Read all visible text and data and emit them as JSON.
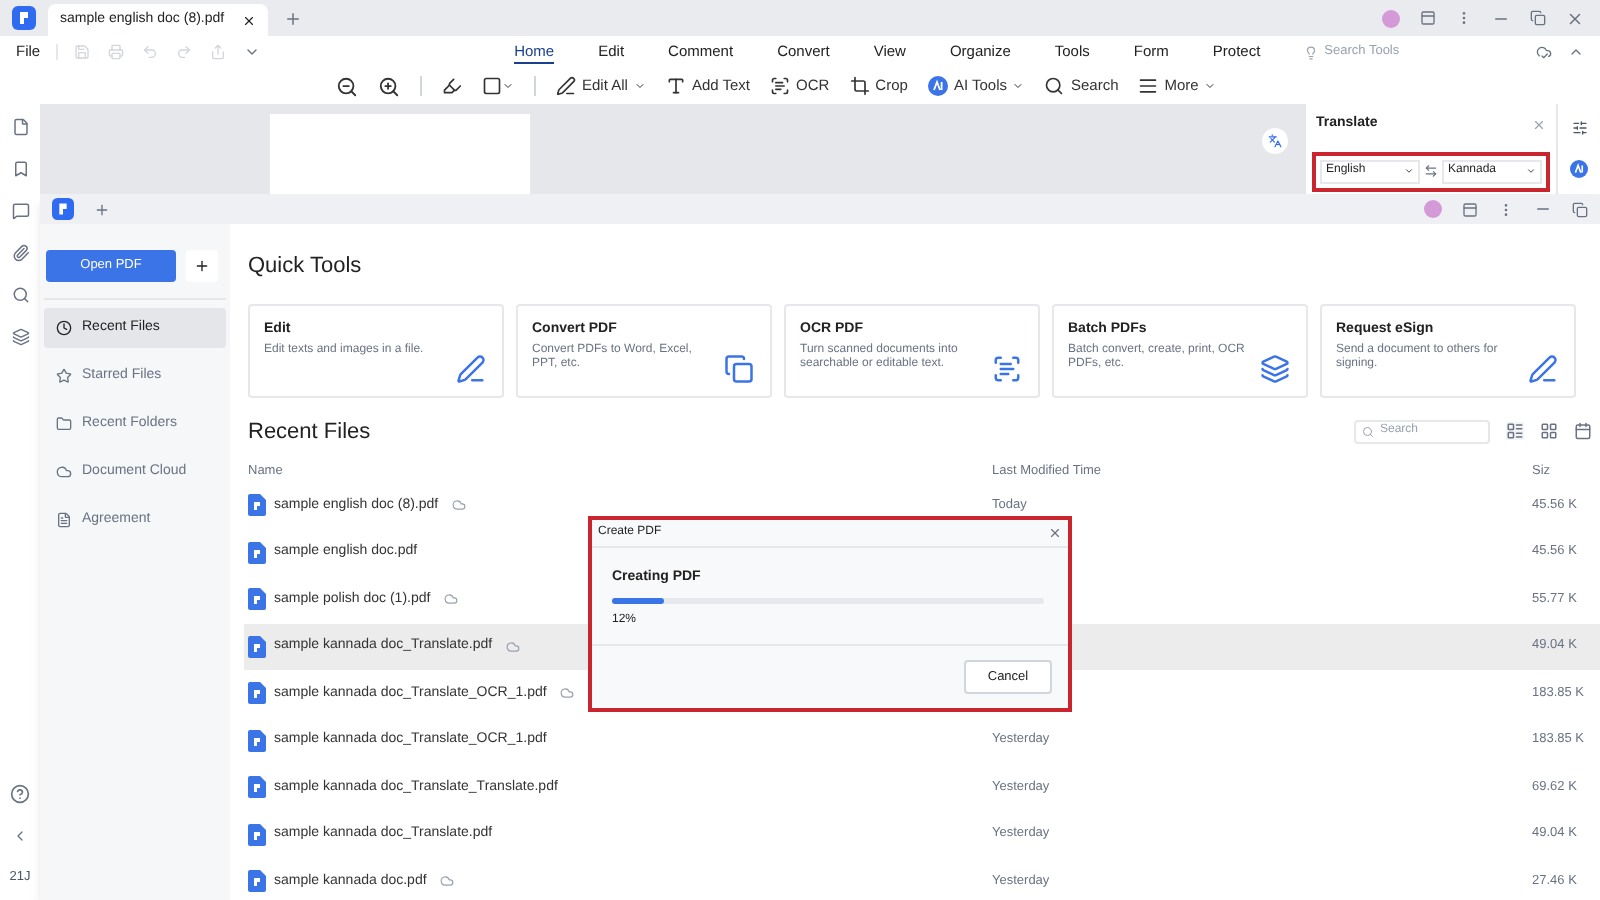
{
  "back_window": {
    "tab_title": "sample english doc (8).pdf",
    "file_menu": "File",
    "ribbon_tabs": [
      {
        "label": "Home",
        "selected": true
      },
      {
        "label": "Edit",
        "selected": false
      },
      {
        "label": "Comment",
        "selected": false
      },
      {
        "label": "Convert",
        "selected": false
      },
      {
        "label": "View",
        "selected": false
      },
      {
        "label": "Organize",
        "selected": false
      },
      {
        "label": "Tools",
        "selected": false
      },
      {
        "label": "Form",
        "selected": false
      },
      {
        "label": "Protect",
        "selected": false
      }
    ],
    "search_tools": {
      "placeholder": "Search Tools"
    },
    "toolbar_buttons": [
      {
        "label": "Edit All",
        "dropdown": true
      },
      {
        "label": "Add Text",
        "dropdown": false
      },
      {
        "label": "OCR",
        "dropdown": false
      },
      {
        "label": "Crop",
        "dropdown": false
      },
      {
        "label": "AI Tools",
        "dropdown": true
      },
      {
        "label": "Search",
        "dropdown": false
      },
      {
        "label": "More",
        "dropdown": true
      }
    ],
    "translate_panel": {
      "title": "Translate",
      "source_language": "English",
      "target_language": "Kannada"
    },
    "rail_label": "21J"
  },
  "home_window": {
    "open_pdf": "Open PDF",
    "nav_items": [
      {
        "label": "Recent Files",
        "selected": true
      },
      {
        "label": "Starred Files",
        "selected": false
      },
      {
        "label": "Recent Folders",
        "selected": false
      },
      {
        "label": "Document Cloud",
        "selected": false
      },
      {
        "label": "Agreement",
        "selected": false
      }
    ],
    "quick_tools_title": "Quick Tools",
    "quick_tools": [
      {
        "title": "Edit",
        "description": "Edit texts and images in a file."
      },
      {
        "title": "Convert PDF",
        "description": "Convert PDFs to Word, Excel, PPT, etc."
      },
      {
        "title": "OCR PDF",
        "description": "Turn scanned documents into searchable or editable text."
      },
      {
        "title": "Batch PDFs",
        "description": "Batch convert, create, print, OCR PDFs, etc."
      },
      {
        "title": "Request eSign",
        "description": "Send a document to others for signing."
      }
    ],
    "recent_title": "Recent Files",
    "search": {
      "placeholder": "Search"
    },
    "columns": [
      "Name",
      "Last Modified Time",
      "Siz"
    ],
    "rows": [
      {
        "name": "sample english doc (8).pdf",
        "cloud": true,
        "time": "Today",
        "size": "45.56 K",
        "selected": false
      },
      {
        "name": "sample english doc.pdf",
        "cloud": false,
        "size": "45.56 K",
        "selected": false
      },
      {
        "name": "sample polish doc (1).pdf",
        "cloud": true,
        "size": "55.77 K",
        "selected": false
      },
      {
        "name": "sample kannada doc_Translate.pdf",
        "cloud": true,
        "size": "49.04 K",
        "selected": true
      },
      {
        "name": "sample kannada doc_Translate_OCR_1.pdf",
        "cloud": true,
        "size": "183.85 K",
        "selected": false
      },
      {
        "name": "sample kannada doc_Translate_OCR_1.pdf",
        "cloud": false,
        "time": "Yesterday",
        "size": "183.85 K",
        "selected": false
      },
      {
        "name": "sample kannada doc_Translate_Translate.pdf",
        "cloud": false,
        "time": "Yesterday",
        "size": "69.62 K",
        "selected": false
      },
      {
        "name": "sample kannada doc_Translate.pdf",
        "cloud": false,
        "time": "Yesterday",
        "size": "49.04 K",
        "selected": false
      },
      {
        "name": "sample kannada doc.pdf",
        "cloud": true,
        "time": "Yesterday",
        "size": "27.46 K",
        "selected": false
      }
    ]
  },
  "dialog": {
    "title": "Create PDF",
    "heading": "Creating PDF",
    "level": 0.12,
    "reading": "12%",
    "cancel": "Cancel"
  }
}
